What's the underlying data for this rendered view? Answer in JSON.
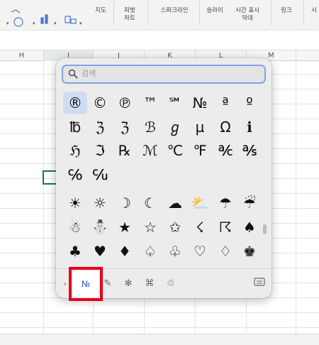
{
  "ribbon": {
    "items": [
      {
        "label": "지도"
      },
      {
        "label": "피벗\n차트"
      },
      {
        "label": "스파크라인"
      },
      {
        "label": "슬라이"
      },
      {
        "label": "시간 표시\n막대"
      },
      {
        "label": "링크"
      }
    ]
  },
  "columns": [
    "H",
    "I",
    "J",
    "K",
    "L",
    "M"
  ],
  "emoji_picker": {
    "search_placeholder": "검색",
    "symbols": [
      [
        "®",
        "©",
        "℗",
        "™",
        "℠",
        "№",
        "ª",
        "º"
      ],
      [
        "℔",
        "ℨ",
        "ℨ",
        "ℬ",
        "ℊ",
        "µ",
        "Ω",
        "ℹ"
      ],
      [
        "ℌ",
        "ℑ",
        "℞",
        "ℳ",
        "℃",
        "℉",
        "℀",
        "℁"
      ],
      [
        "℅",
        "℆"
      ],
      [
        "☀",
        "☼",
        "☽",
        "☾",
        "☁",
        "⛅",
        "☂",
        "☔"
      ],
      [
        "☃",
        "⛄",
        "★",
        "☆",
        "✩",
        "☇",
        "☈",
        "♠"
      ],
      [
        "♣",
        "♥",
        "♦",
        "♤",
        "♧",
        "♡",
        "♢",
        "♚"
      ]
    ],
    "categories": [
      {
        "name": "letterlike-symbols",
        "glyph": "№"
      },
      {
        "name": "pencil",
        "glyph": "✎"
      },
      {
        "name": "asterisk",
        "glyph": "✻"
      },
      {
        "name": "command",
        "glyph": "⌘"
      },
      {
        "name": "recycle",
        "glyph": "♲"
      }
    ],
    "accent_color": "#7fa5e6",
    "highlight_color": "#e5001b"
  }
}
